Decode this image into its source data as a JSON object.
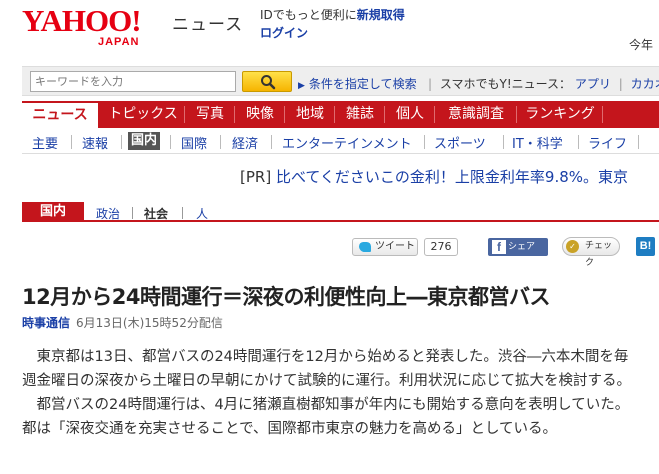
{
  "header": {
    "logo_main": "YAHOO!",
    "logo_sub": "JAPAN",
    "service_name": "ニュース",
    "login_msg_prefix": "IDでもっと便利に",
    "login_msg_link": "新規取得",
    "login_link": "ログイン",
    "today": "今年"
  },
  "search": {
    "placeholder": "キーワードを入力",
    "advanced_label": "条件を指定して検索",
    "sp_label": "スマホでもY!ニュース：",
    "sp_app": "アプリ",
    "sp_cal": "カカオ"
  },
  "main_nav": [
    "ニュース",
    "トピックス",
    "写真",
    "映像",
    "地域",
    "雑誌",
    "個人",
    "意識調査",
    "ランキング"
  ],
  "sub_nav": [
    "主要",
    "速報",
    "国内",
    "国際",
    "経済",
    "エンターテインメント",
    "スポーツ",
    "IT・科学",
    "ライフ"
  ],
  "pr": {
    "tag": "[PR]",
    "text": "比べてくださいこの金利！上限金利年率9.8%。東京"
  },
  "category": {
    "label": "国内",
    "crumbs": [
      "政治",
      "社会",
      "人"
    ]
  },
  "social": {
    "tweet": "ツイート",
    "tweet_count": "276",
    "share": "シェア",
    "check": "チェック",
    "hatena": "B!"
  },
  "article": {
    "headline": "12月から24時間運行＝深夜の利便性向上―東京都営バス",
    "source": "時事通信",
    "datetime": "6月13日(木)15時52分配信",
    "paragraphs": [
      "　東京都は13日、都営バスの24時間運行を12月から始めると発表した。渋谷―六本木間を毎",
      "週金曜日の深夜から土曜日の早朝にかけて試験的に運行。利用状況に応じて拡大を検討する。",
      "　都営バスの24時間運行は、4月に猪瀬直樹都知事が年内にも開始する意向を表明していた。",
      "都は「深夜交通を充実させることで、国際都市東京の魅力を高める」としている。"
    ]
  },
  "colors": {
    "brand_red": "#e60012",
    "nav_red": "#c4151c",
    "link_blue": "#1a3fa6"
  }
}
